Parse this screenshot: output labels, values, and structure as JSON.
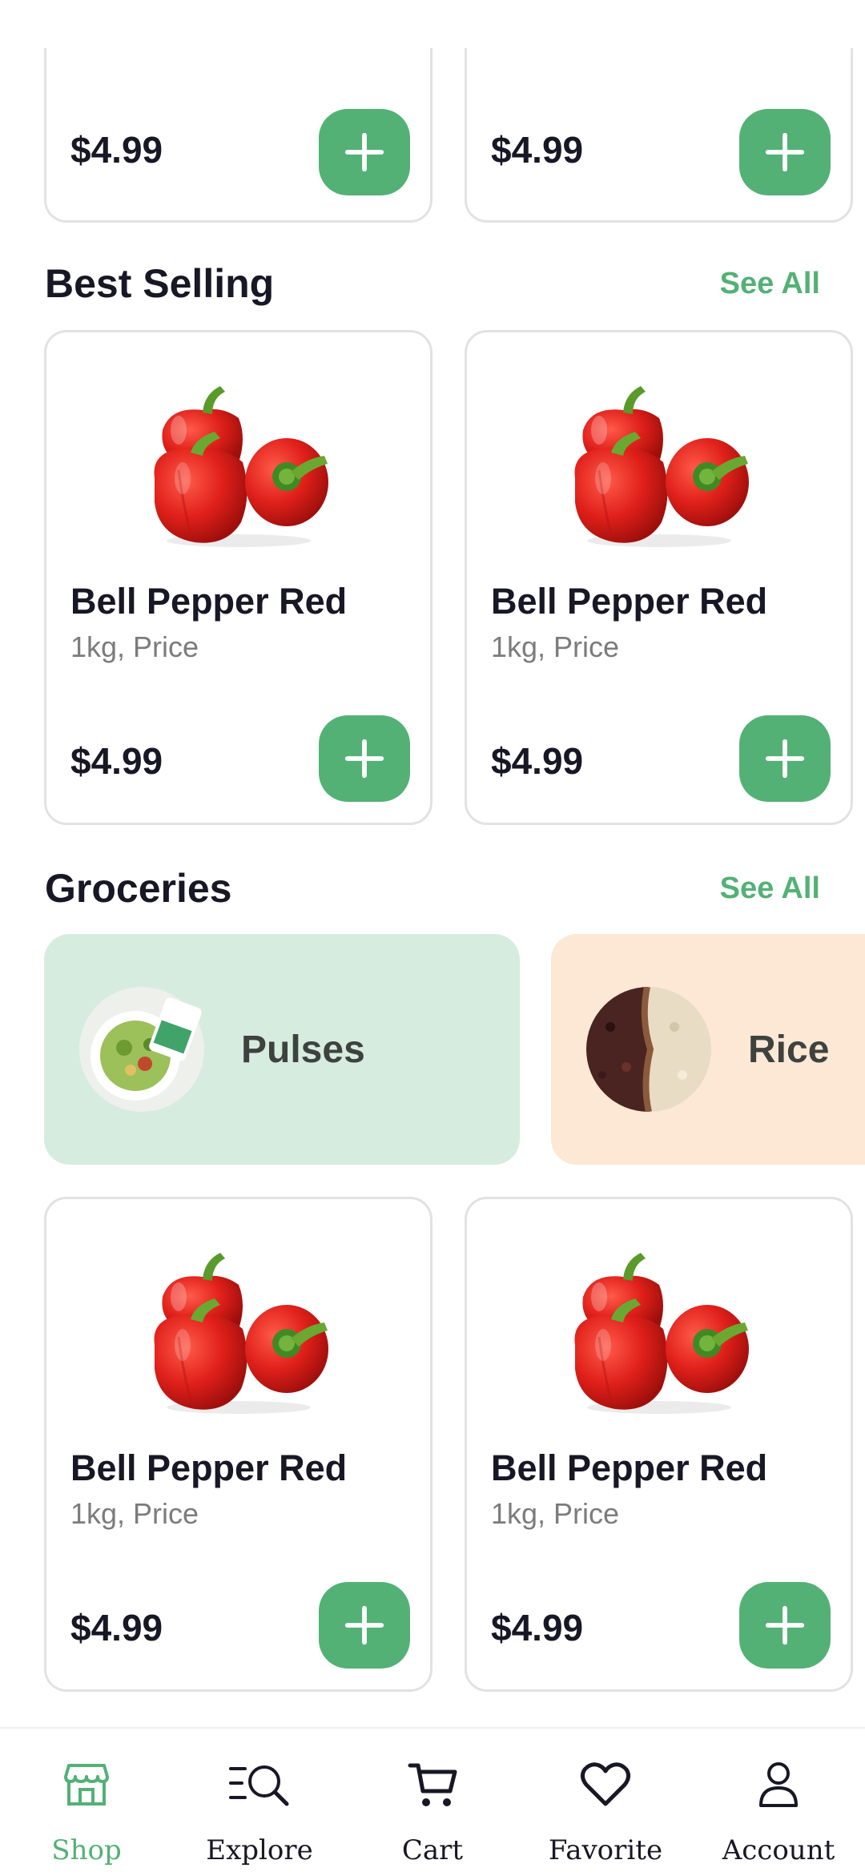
{
  "top_row": [
    {
      "price": "$4.99"
    },
    {
      "price": "$4.99"
    }
  ],
  "best_selling": {
    "title": "Best Selling",
    "see_all": "See All",
    "products": [
      {
        "name": "Bell Pepper Red",
        "subtitle": "1kg, Price",
        "price": "$4.99"
      },
      {
        "name": "Bell Pepper Red",
        "subtitle": "1kg, Price",
        "price": "$4.99"
      }
    ]
  },
  "groceries": {
    "title": "Groceries",
    "see_all": "See All",
    "categories": [
      {
        "label": "Pulses",
        "color": "#d6ecdf"
      },
      {
        "label": "Rice",
        "color": "#fce8d5"
      }
    ],
    "products": [
      {
        "name": "Bell Pepper Red",
        "subtitle": "1kg, Price",
        "price": "$4.99"
      },
      {
        "name": "Bell Pepper Red",
        "subtitle": "1kg, Price",
        "price": "$4.99"
      }
    ]
  },
  "bottom_nav": [
    {
      "label": "Shop",
      "icon": "shop-icon",
      "active": true
    },
    {
      "label": "Explore",
      "icon": "explore-icon",
      "active": false
    },
    {
      "label": "Cart",
      "icon": "cart-icon",
      "active": false
    },
    {
      "label": "Favorite",
      "icon": "heart-icon",
      "active": false
    },
    {
      "label": "Account",
      "icon": "account-icon",
      "active": false
    }
  ],
  "colors": {
    "accent": "#53b175",
    "text": "#181725",
    "muted": "#7c7c7c",
    "border": "#e2e2e2"
  }
}
